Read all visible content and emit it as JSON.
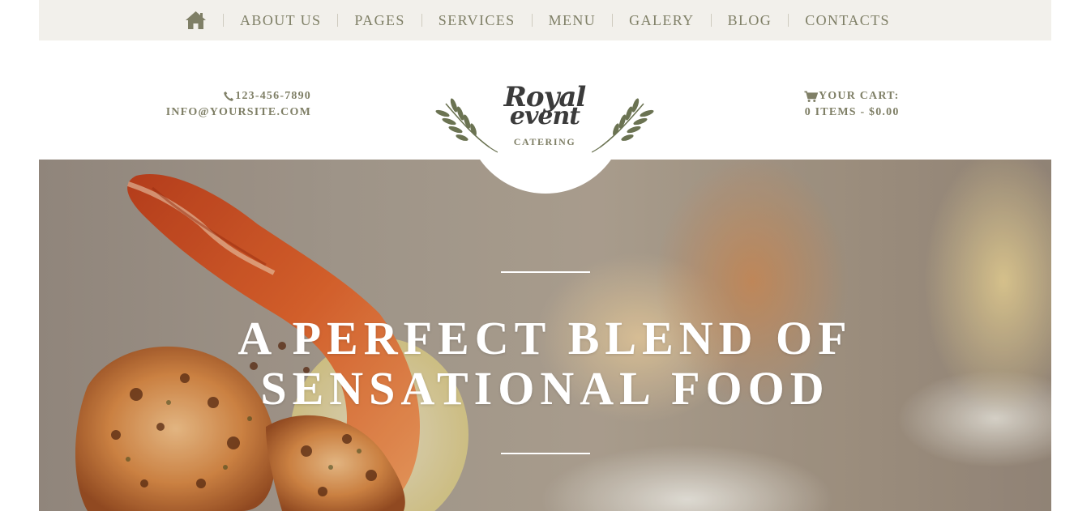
{
  "nav": {
    "home_icon": "home-icon",
    "items": [
      {
        "label": "ABOUT US"
      },
      {
        "label": "PAGES"
      },
      {
        "label": "SERVICES"
      },
      {
        "label": "MENU"
      },
      {
        "label": "GALERY"
      },
      {
        "label": "BLOG"
      },
      {
        "label": "CONTACTS"
      }
    ]
  },
  "header": {
    "phone": "123-456-7890",
    "email": "INFO@YOURSITE.COM",
    "phone_icon": "phone-icon",
    "cart_icon": "cart-icon",
    "cart_label": "YOUR CART:",
    "cart_summary": "0 ITEMS - $0.00"
  },
  "logo": {
    "line1": "Royal",
    "line2": "event",
    "subtitle": "CATERING"
  },
  "hero": {
    "title_line1": "A PERFECT BLEND OF",
    "title_line2": "SENSATIONAL FOOD"
  },
  "colors": {
    "nav_background": "#f2f0eb",
    "text_olive": "#7f7f66",
    "logo_dark": "#3b3b3b",
    "leaf_green": "#6b7352",
    "hero_text": "#ffffff"
  }
}
